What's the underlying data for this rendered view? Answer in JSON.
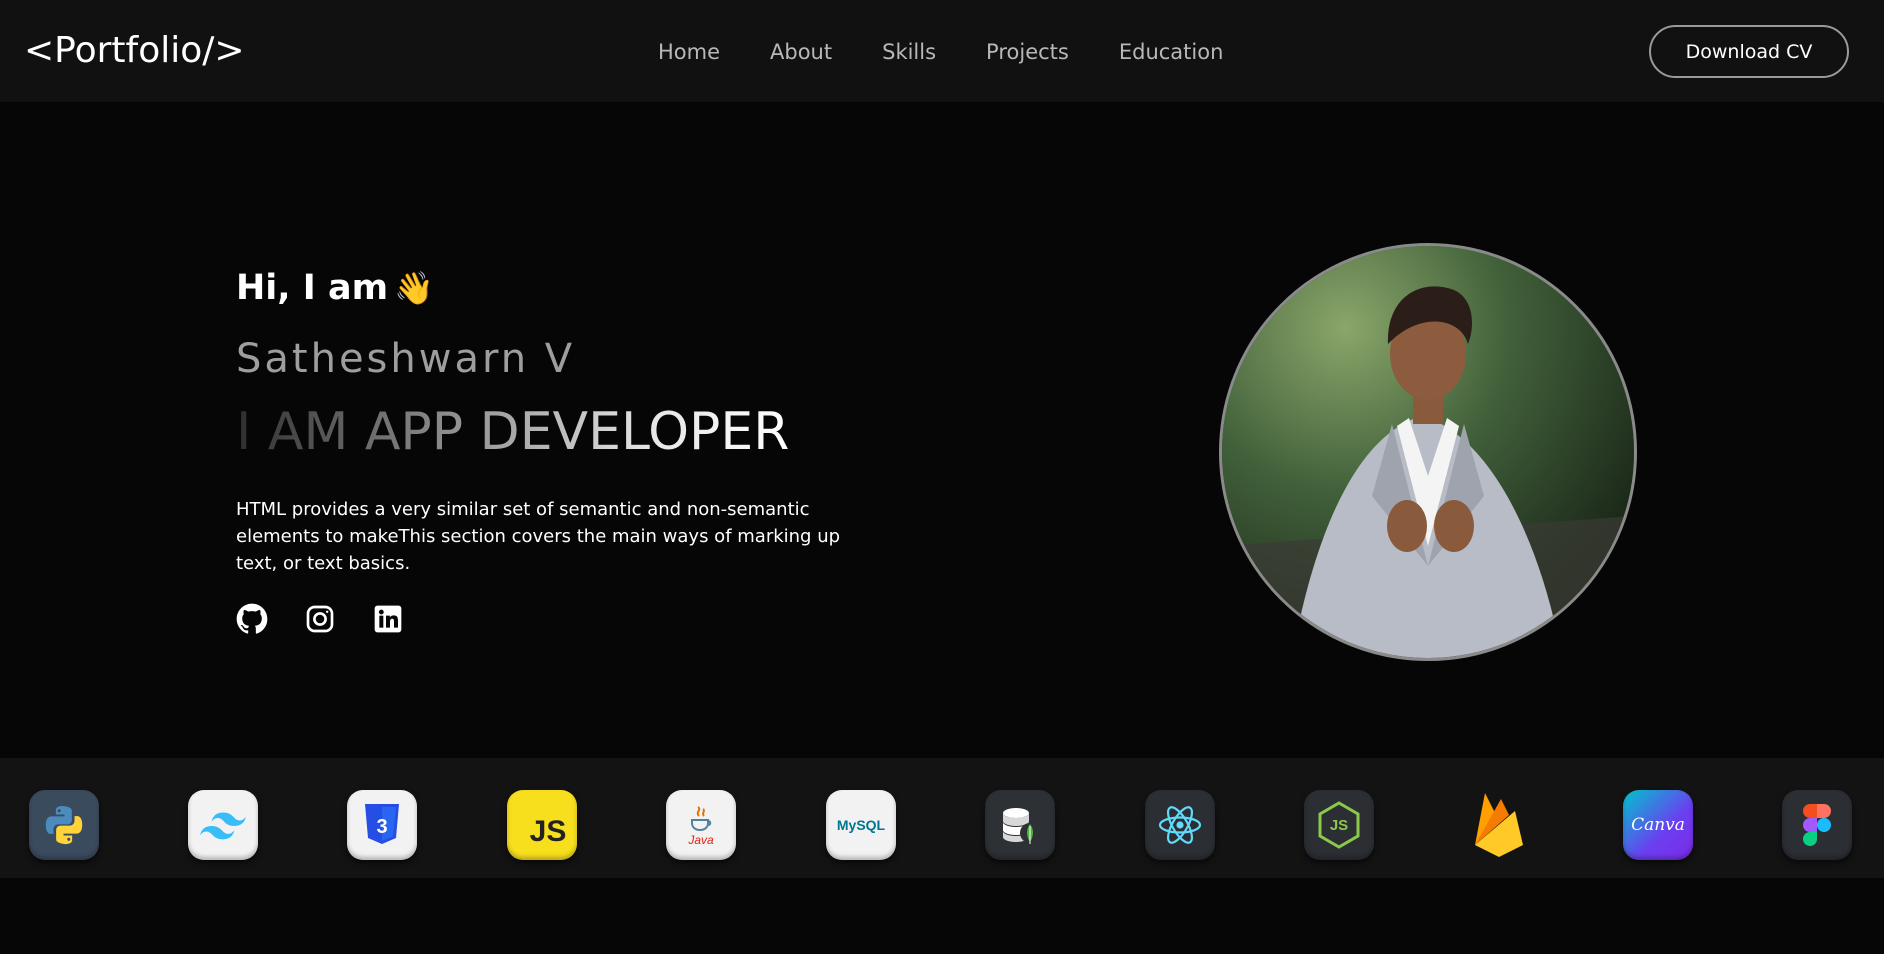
{
  "navbar": {
    "logo": "<Portfolio/>",
    "links": [
      {
        "label": "Home"
      },
      {
        "label": "About"
      },
      {
        "label": "Skills"
      },
      {
        "label": "Projects"
      },
      {
        "label": "Education"
      }
    ],
    "cta_label": "Download CV"
  },
  "hero": {
    "greeting": "Hi, I am",
    "greeting_emoji": "👋",
    "name": "Satheshwarn V",
    "role": "I AM APP DEVELOPER",
    "description": "HTML provides a very similar set of semantic and non-semantic elements to makeThis section covers the main ways of marking up text, or text basics.",
    "socials": [
      {
        "icon": "github-icon"
      },
      {
        "icon": "instagram-icon"
      },
      {
        "icon": "linkedin-icon"
      }
    ]
  },
  "tech_stack": [
    {
      "icon": "python-icon",
      "color": "#3776ab"
    },
    {
      "icon": "tailwind-icon",
      "color": "#38bdf8"
    },
    {
      "icon": "css3-icon",
      "color": "#264de4"
    },
    {
      "icon": "javascript-icon",
      "label": "JS",
      "color": "#f7df1e"
    },
    {
      "icon": "java-icon",
      "label": "Java",
      "color": "#e76f00"
    },
    {
      "icon": "mysql-icon",
      "label": "MySQL",
      "color": "#00758f"
    },
    {
      "icon": "mongodb-database-icon",
      "color": "#4db33d"
    },
    {
      "icon": "react-icon",
      "color": "#61dafb"
    },
    {
      "icon": "nodejs-icon",
      "label": "JS",
      "color": "#8cc84b"
    },
    {
      "icon": "firebase-icon",
      "color": "#ffca28"
    },
    {
      "icon": "canva-icon",
      "label": "Canva",
      "color": "#7d2ae8"
    },
    {
      "icon": "figma-icon",
      "color": "#f24e1e"
    }
  ]
}
